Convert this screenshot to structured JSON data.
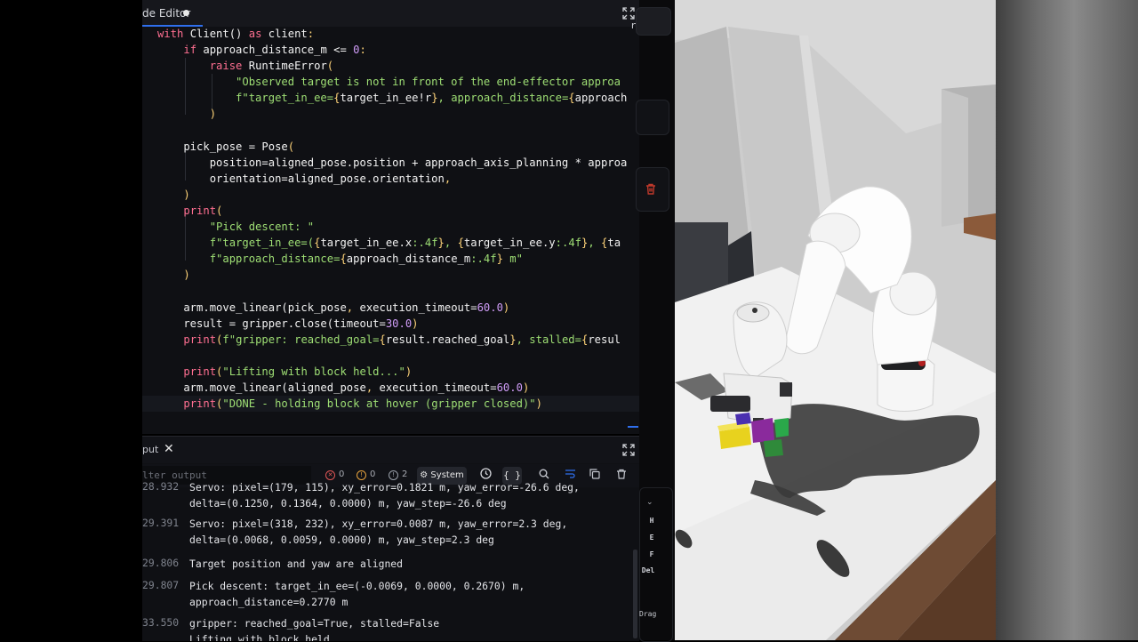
{
  "editor": {
    "title": "de Editor",
    "maximize_icon": "expand-icon"
  },
  "code_lines": [
    [
      [
        "k",
        "with "
      ],
      [
        "fn",
        "Client"
      ],
      [
        "v",
        "() "
      ],
      [
        "k",
        "as "
      ],
      [
        "v",
        "client"
      ],
      [
        "p",
        ":"
      ]
    ],
    [
      [
        "v",
        "    "
      ],
      [
        "k",
        "if "
      ],
      [
        "v",
        "approach_distance_m <= "
      ],
      [
        "n",
        "0"
      ],
      [
        "p",
        ":"
      ]
    ],
    [
      [
        "v",
        "        "
      ],
      [
        "k",
        "raise "
      ],
      [
        "fn",
        "RuntimeError"
      ],
      [
        "p",
        "("
      ]
    ],
    [
      [
        "s",
        "            \"Observed target is not in front of the end-effector approa"
      ]
    ],
    [
      [
        "s",
        "            f\"target_in_ee="
      ],
      [
        "p",
        "{"
      ],
      [
        "v",
        "target_in_ee!r"
      ],
      [
        "p",
        "}"
      ],
      [
        "s",
        ", approach_distance="
      ],
      [
        "p",
        "{"
      ],
      [
        "v",
        "approach"
      ]
    ],
    [
      [
        "v",
        "        "
      ],
      [
        "p",
        ")"
      ]
    ],
    [
      [
        "v",
        ""
      ]
    ],
    [
      [
        "v",
        "    pick_pose = "
      ],
      [
        "fn",
        "Pose"
      ],
      [
        "p",
        "("
      ]
    ],
    [
      [
        "v",
        "        position=aligned_pose.position + approach_axis_planning * approa"
      ]
    ],
    [
      [
        "v",
        "        orientation=aligned_pose.orientation"
      ],
      [
        "p",
        ","
      ]
    ],
    [
      [
        "v",
        "    "
      ],
      [
        "p",
        ")"
      ]
    ],
    [
      [
        "v",
        "    "
      ],
      [
        "k",
        "print"
      ],
      [
        "p",
        "("
      ]
    ],
    [
      [
        "s",
        "        \"Pick descent: \""
      ]
    ],
    [
      [
        "s",
        "        f\"target_in_ee=("
      ],
      [
        "p",
        "{"
      ],
      [
        "v",
        "target_in_ee.x"
      ],
      [
        "s",
        ":.4f"
      ],
      [
        "p",
        "}"
      ],
      [
        "s",
        ", "
      ],
      [
        "p",
        "{"
      ],
      [
        "v",
        "target_in_ee.y"
      ],
      [
        "s",
        ":.4f"
      ],
      [
        "p",
        "}"
      ],
      [
        "s",
        ", "
      ],
      [
        "p",
        "{"
      ],
      [
        "v",
        "ta"
      ]
    ],
    [
      [
        "s",
        "        f\"approach_distance="
      ],
      [
        "p",
        "{"
      ],
      [
        "v",
        "approach_distance_m"
      ],
      [
        "s",
        ":.4f"
      ],
      [
        "p",
        "}"
      ],
      [
        "s",
        " m\""
      ]
    ],
    [
      [
        "v",
        "    "
      ],
      [
        "p",
        ")"
      ]
    ],
    [
      [
        "v",
        ""
      ]
    ],
    [
      [
        "v",
        "    arm.move_linear(pick_pose"
      ],
      [
        "p",
        ","
      ],
      [
        "v",
        " execution_timeout="
      ],
      [
        "n",
        "60.0"
      ],
      [
        "p",
        ")"
      ]
    ],
    [
      [
        "v",
        "    result = gripper.close(timeout="
      ],
      [
        "n",
        "30.0"
      ],
      [
        "p",
        ")"
      ]
    ],
    [
      [
        "v",
        "    "
      ],
      [
        "k",
        "print"
      ],
      [
        "p",
        "("
      ],
      [
        "s",
        "f\"gripper: reached_goal="
      ],
      [
        "p",
        "{"
      ],
      [
        "v",
        "result.reached_goal"
      ],
      [
        "p",
        "}"
      ],
      [
        "s",
        ", stalled="
      ],
      [
        "p",
        "{"
      ],
      [
        "v",
        "resul"
      ]
    ],
    [
      [
        "v",
        ""
      ]
    ],
    [
      [
        "v",
        "    "
      ],
      [
        "k",
        "print"
      ],
      [
        "p",
        "("
      ],
      [
        "s",
        "\"Lifting with block held...\""
      ],
      [
        "p",
        ")"
      ]
    ],
    [
      [
        "v",
        "    arm.move_linear(aligned_pose"
      ],
      [
        "p",
        ","
      ],
      [
        "v",
        " execution_timeout="
      ],
      [
        "n",
        "60.0"
      ],
      [
        "p",
        ")"
      ]
    ],
    [
      [
        "v",
        "    "
      ],
      [
        "k",
        "print"
      ],
      [
        "p",
        "("
      ],
      [
        "s",
        "\"DONE - holding block at hover (gripper closed)\""
      ],
      [
        "p",
        ")"
      ]
    ]
  ],
  "output": {
    "title": "put",
    "filter_placeholder": "lter output",
    "errors": "0",
    "warnings": "0",
    "infos": "2",
    "source_filter": "System",
    "log": [
      {
        "ts": "28.932",
        "msg": "Servo: pixel=(179, 115), xy_error=0.1821 m, yaw_error=-26.6 deg,\ndelta=(0.1250, 0.1364, 0.0000) m, yaw_step=-26.6 deg"
      },
      {
        "ts": "29.391",
        "msg": "Servo: pixel=(318, 232), xy_error=0.0087 m, yaw_error=2.3 deg,\ndelta=(0.0068, 0.0059, 0.0000) m, yaw_step=2.3 deg"
      },
      {
        "ts": "29.806",
        "msg": "Target position and yaw are aligned"
      },
      {
        "ts": "29.807",
        "msg": "Pick descent: target_in_ee=(-0.0069, 0.0000, 0.2670) m,\napproach_distance=0.2770 m"
      },
      {
        "ts": "33.550",
        "msg": "gripper: reached_goal=True, stalled=False\nLifting with block held..."
      }
    ]
  },
  "sidebar": {
    "shortcut_keys": [
      "H",
      "E",
      "F",
      "Del"
    ],
    "drag_label": "Drag",
    "edge_char": "r"
  },
  "colors": {
    "accent": "#2f6fed",
    "delete": "#c0392b",
    "error": "#e05656",
    "warning": "#e8a33d",
    "info": "#9aa0aa"
  }
}
